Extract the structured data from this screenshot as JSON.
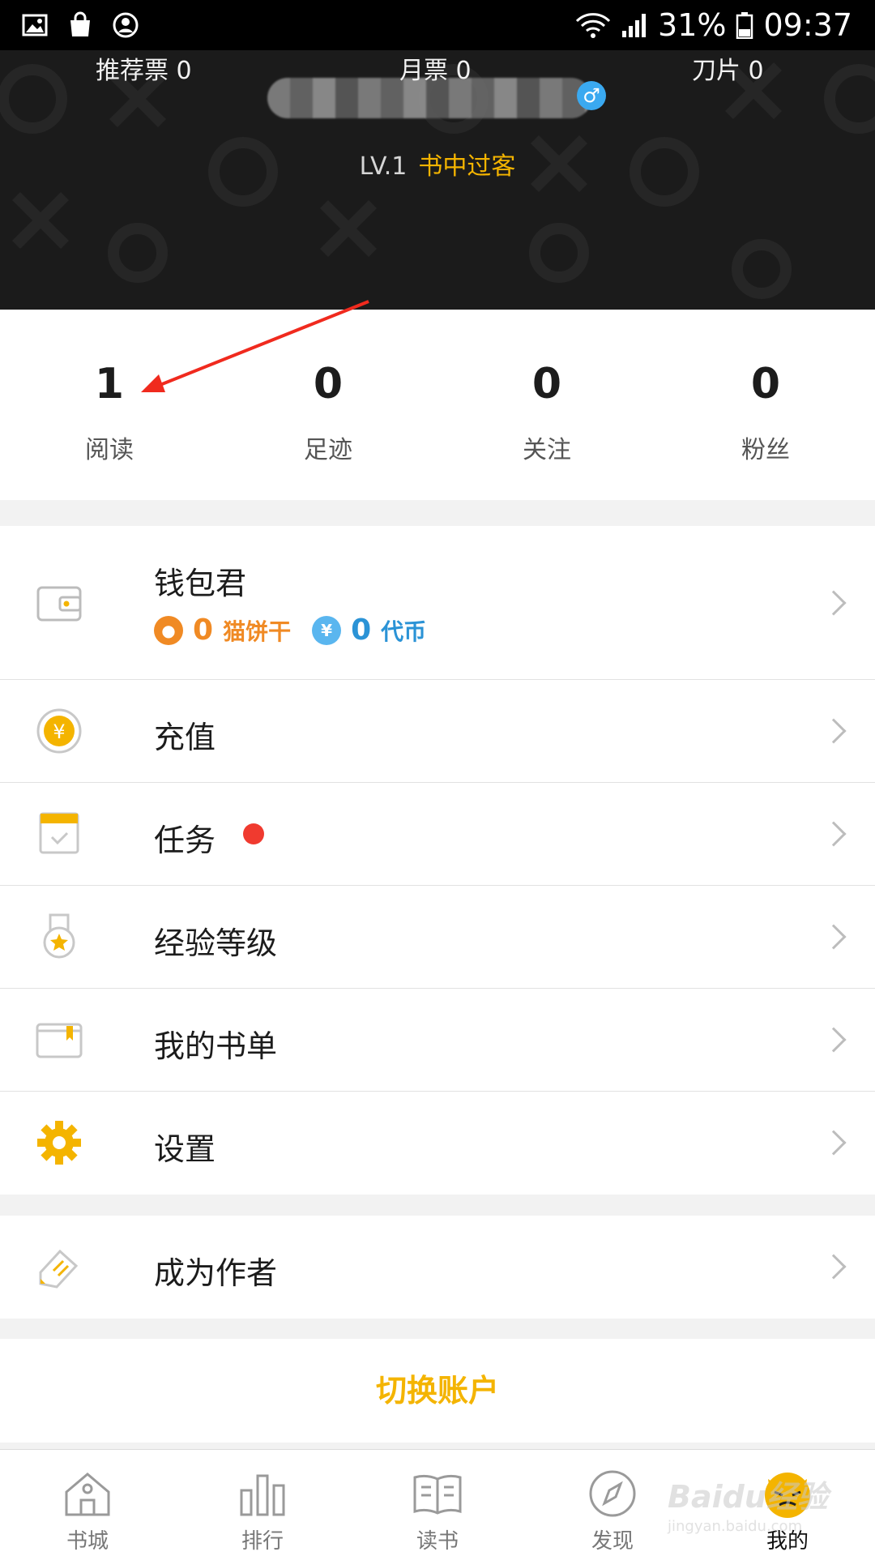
{
  "status_bar": {
    "battery": "31%",
    "time": "09:37"
  },
  "header": {
    "level": "LV.1",
    "level_title": "书中过客",
    "gender_symbol": "♂",
    "tickets": [
      {
        "label": "推荐票 0"
      },
      {
        "label": "月票 0"
      },
      {
        "label": "刀片 0"
      }
    ]
  },
  "stats": [
    {
      "value": "1",
      "label": "阅读"
    },
    {
      "value": "0",
      "label": "足迹"
    },
    {
      "value": "0",
      "label": "关注"
    },
    {
      "value": "0",
      "label": "粉丝"
    }
  ],
  "menu": {
    "wallet": {
      "label": "钱包君",
      "cookie_amount": "0",
      "cookie_label": "猫饼干",
      "coin_amount": "0",
      "coin_label": "代币",
      "coin_symbol": "¥"
    },
    "recharge": {
      "label": "充值"
    },
    "tasks": {
      "label": "任务"
    },
    "experience": {
      "label": "经验等级"
    },
    "booklist": {
      "label": "我的书单"
    },
    "settings": {
      "label": "设置"
    },
    "author": {
      "label": "成为作者"
    }
  },
  "switch_account": "切换账户",
  "bottom_nav": [
    {
      "label": "书城",
      "icon": "house-icon"
    },
    {
      "label": "排行",
      "icon": "bar-chart-icon"
    },
    {
      "label": "读书",
      "icon": "open-book-icon"
    },
    {
      "label": "发现",
      "icon": "compass-icon"
    },
    {
      "label": "我的",
      "icon": "cat-avatar-icon"
    }
  ],
  "watermark": {
    "brand": "Baidu经验",
    "url": "jingyan.baidu.com"
  },
  "colors": {
    "accent": "#f4b400",
    "header_bg": "#1b1b1b",
    "red_dot": "#f03a2f",
    "coin_orange": "#f08a24",
    "coin_blue": "#2b93d6"
  }
}
